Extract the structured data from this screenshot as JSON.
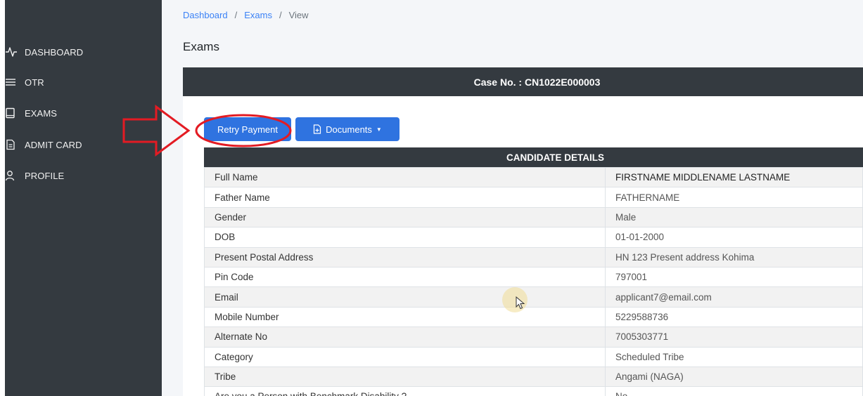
{
  "sidebar": {
    "items": [
      {
        "label": "DASHBOARD",
        "icon": "activity-icon"
      },
      {
        "label": "OTR",
        "icon": "menu-icon"
      },
      {
        "label": "EXAMS",
        "icon": "book-icon"
      },
      {
        "label": "ADMIT CARD",
        "icon": "file-text-icon"
      },
      {
        "label": "PROFILE",
        "icon": "user-icon"
      }
    ]
  },
  "breadcrumb": {
    "dashboard": "Dashboard",
    "exams": "Exams",
    "current": "View",
    "separator": "/"
  },
  "page_title": "Exams",
  "case": {
    "label": "Case No. : CN1022E000003"
  },
  "actions": {
    "retry_label": "Retry Payment",
    "documents_label": "Documents"
  },
  "candidate": {
    "heading": "CANDIDATE DETAILS",
    "rows": [
      {
        "key": "Full Name",
        "value": "FIRSTNAME MIDDLENAME LASTNAME"
      },
      {
        "key": "Father Name",
        "value": "FATHERNAME"
      },
      {
        "key": "Gender",
        "value": "Male"
      },
      {
        "key": "DOB",
        "value": "01-01-2000"
      },
      {
        "key": "Present Postal Address",
        "value": "HN 123 Present address Kohima"
      },
      {
        "key": "Pin Code",
        "value": "797001"
      },
      {
        "key": "Email",
        "value": "applicant7@email.com"
      },
      {
        "key": "Mobile Number",
        "value": "5229588736"
      },
      {
        "key": "Alternate No",
        "value": "7005303771"
      },
      {
        "key": "Category",
        "value": "Scheduled Tribe"
      },
      {
        "key": "Tribe",
        "value": "Angami (NAGA)"
      },
      {
        "key": "Are you a Person with Benchmark Disability ?",
        "value": "No"
      }
    ]
  },
  "colors": {
    "sidebar_bg": "#343a40",
    "primary": "#2f73e0",
    "annotation_red": "#e31b23"
  }
}
